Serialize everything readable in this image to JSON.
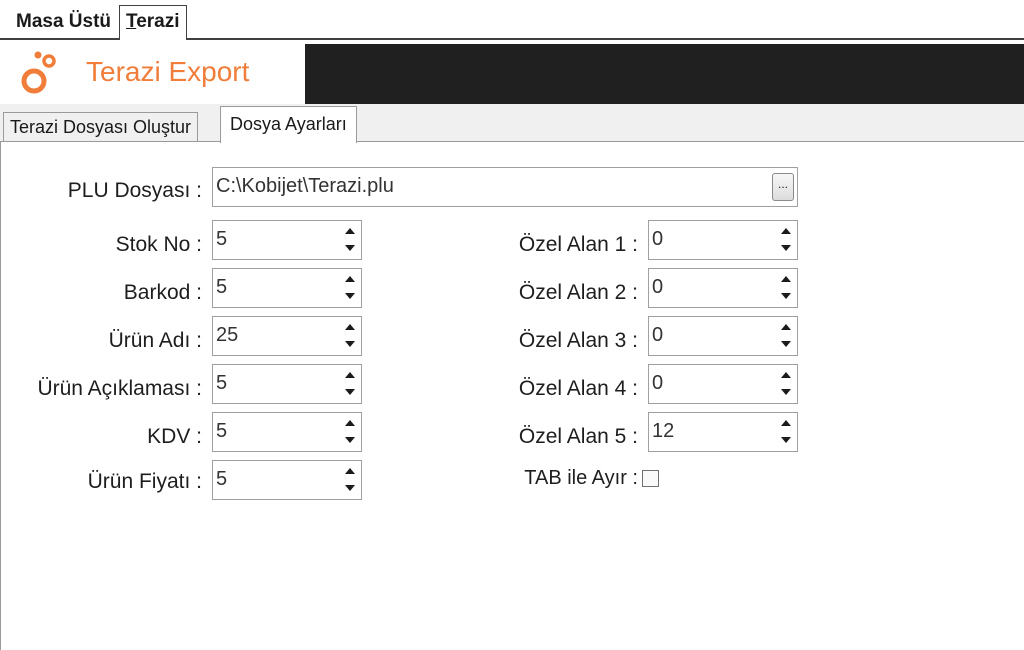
{
  "top_tabs": [
    {
      "label": "Masa Üstü"
    },
    {
      "label_underlined": "T",
      "label_rest": "erazi"
    }
  ],
  "header": {
    "title": "Terazi Export"
  },
  "inner_tabs": [
    "Terazi Dosyası Oluştur",
    "Dosya Ayarları"
  ],
  "plu": {
    "label": "PLU Dosyası :",
    "value": "C:\\Kobijet\\Terazi.plu",
    "browse_label": "..."
  },
  "left_fields": [
    {
      "label": "Stok No :",
      "value": "5"
    },
    {
      "label": "Barkod :",
      "value": "5"
    },
    {
      "label": "Ürün Adı :",
      "value": "25"
    },
    {
      "label": "Ürün Açıklaması :",
      "value": "5"
    },
    {
      "label": "KDV :",
      "value": "5"
    },
    {
      "label": "Ürün Fiyatı :",
      "value": "5"
    }
  ],
  "right_fields": [
    {
      "label": "Özel Alan 1 :",
      "value": "0"
    },
    {
      "label": "Özel Alan 2 :",
      "value": "0"
    },
    {
      "label": "Özel Alan 3 :",
      "value": "0"
    },
    {
      "label": "Özel Alan 4 :",
      "value": "0"
    },
    {
      "label": "Özel Alan 5 :",
      "value": "12"
    }
  ],
  "tab_separator": {
    "label": "TAB ile Ayır :",
    "checked": false
  },
  "colors": {
    "accent": "#f07d3a",
    "header_dark": "#202020"
  },
  "icons": [
    "logo-icon",
    "browse-icon",
    "spin-up-icon",
    "spin-down-icon"
  ]
}
